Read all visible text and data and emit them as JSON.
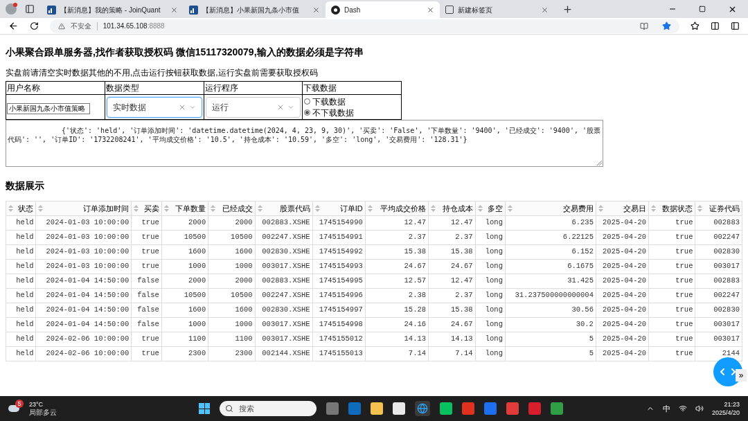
{
  "browser": {
    "tabs": [
      {
        "kind": "chart",
        "label": "【新消息】我的策略 - JoinQuant",
        "selected": false
      },
      {
        "kind": "chart",
        "label": "【新消息】小果新国九条小市值",
        "selected": false
      },
      {
        "kind": "dash",
        "label": "Dash",
        "selected": true
      },
      {
        "kind": "page",
        "label": "新建标签页",
        "selected": false
      }
    ],
    "security": "不安全",
    "url_host": "101.34.65.108",
    "url_port": ":8888"
  },
  "page": {
    "title": "小果聚合跟单服务器,找作者获取授权码 微信15117320079,输入的数据必须是字符串",
    "notice": "实盘前请清空实时数据其他的不用,点击运行按钮获取数据,运行实盘前需要获取授权码",
    "form": {
      "headers": [
        "用户名称",
        "数据类型",
        "运行程序",
        "下载数据"
      ],
      "username": "小果新国九条小市值策略",
      "data_type": {
        "value": "实时数据",
        "focused": true
      },
      "program": {
        "value": "运行",
        "focused": false
      },
      "download": [
        {
          "label": "下载数据",
          "selected": false
        },
        {
          "label": "不下载数据",
          "selected": true
        }
      ]
    },
    "output": "{'状态': 'held', '订单添加时间': 'datetime.datetime(2024, 4, 23, 9, 30)', '买卖': 'False', '下单数量': '9400', '已经成交': '9400', '股票代码': '', '订单ID': '1732208241', '平均成交价格': '10.5', '持仓成本': '10.59', '多空': 'long', '交易费用': '128.31'}",
    "section_title": "数据展示",
    "table": {
      "columns": [
        "状态",
        "订单添加时间",
        "买卖",
        "下单数量",
        "已经成交",
        "股票代码",
        "订单ID",
        "平均成交价格",
        "持仓成本",
        "多空",
        "交易费用",
        "交易日",
        "数据状态",
        "证券代码"
      ],
      "rows": [
        [
          "held",
          "2024-01-03 10:00:00",
          "true",
          "2000",
          "2000",
          "002883.XSHE",
          "1745154990",
          "12.47",
          "12.47",
          "long",
          "6.235",
          "2025-04-20",
          "true",
          "002883"
        ],
        [
          "held",
          "2024-01-03 10:00:00",
          "true",
          "10500",
          "10500",
          "002247.XSHE",
          "1745154991",
          "2.37",
          "2.37",
          "long",
          "6.22125",
          "2025-04-20",
          "true",
          "002247"
        ],
        [
          "held",
          "2024-01-03 10:00:00",
          "true",
          "1600",
          "1600",
          "002830.XSHE",
          "1745154992",
          "15.38",
          "15.38",
          "long",
          "6.152",
          "2025-04-20",
          "true",
          "002830"
        ],
        [
          "held",
          "2024-01-03 10:00:00",
          "true",
          "1000",
          "1000",
          "003017.XSHE",
          "1745154993",
          "24.67",
          "24.67",
          "long",
          "6.1675",
          "2025-04-20",
          "true",
          "003017"
        ],
        [
          "held",
          "2024-01-04 14:50:00",
          "false",
          "2000",
          "2000",
          "002883.XSHE",
          "1745154995",
          "12.57",
          "12.47",
          "long",
          "31.425",
          "2025-04-20",
          "true",
          "002883"
        ],
        [
          "held",
          "2024-01-04 14:50:00",
          "false",
          "10500",
          "10500",
          "002247.XSHE",
          "1745154996",
          "2.38",
          "2.37",
          "long",
          "31.237500000000004",
          "2025-04-20",
          "true",
          "002247"
        ],
        [
          "held",
          "2024-01-04 14:50:00",
          "false",
          "1600",
          "1600",
          "002830.XSHE",
          "1745154997",
          "15.28",
          "15.38",
          "long",
          "30.56",
          "2025-04-20",
          "true",
          "002830"
        ],
        [
          "held",
          "2024-01-04 14:50:00",
          "false",
          "1000",
          "1000",
          "003017.XSHE",
          "1745154998",
          "24.16",
          "24.67",
          "long",
          "30.2",
          "2025-04-20",
          "true",
          "003017"
        ],
        [
          "held",
          "2024-02-06 10:00:00",
          "true",
          "1100",
          "1100",
          "003017.XSHE",
          "1745155012",
          "14.13",
          "14.13",
          "long",
          "5",
          "2025-04-20",
          "true",
          "003017"
        ],
        [
          "held",
          "2024-02-06 10:00:00",
          "true",
          "2300",
          "2300",
          "002144.XSHE",
          "1745155013",
          "7.14",
          "7.14",
          "long",
          "5",
          "2025-04-20",
          "true",
          "2144"
        ]
      ]
    },
    "more_button": "»"
  },
  "taskbar": {
    "temperature": "23°C",
    "weather": "局部多云",
    "weather_badge": "5",
    "search_placeholder": "搜索",
    "ime": "中",
    "time": "21:23",
    "date": "2025/4/20"
  }
}
